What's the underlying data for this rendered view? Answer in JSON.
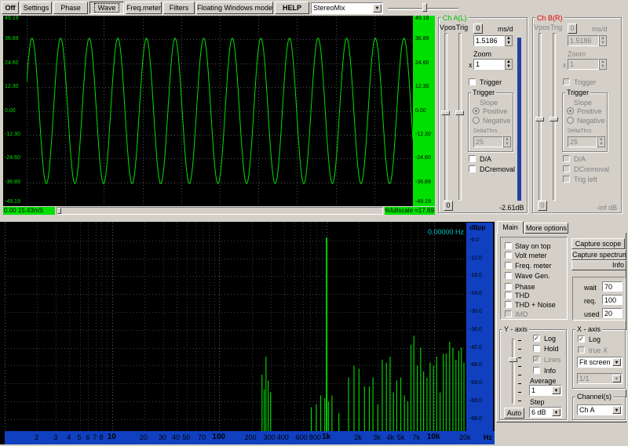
{
  "toolbar": {
    "off": "Off",
    "settings": "Settings",
    "phase": "Phase",
    "wave": "Wave",
    "freqmeter": "Freq.meter",
    "filters": "Filters",
    "floating": "Floating Windows mode",
    "help": "HELP",
    "source": "StereoMix"
  },
  "scope": {
    "y_ticks_left": [
      "49.19",
      "36.89",
      "24.60",
      "12.30",
      "0.00",
      "-12.30",
      "-24.60",
      "-36.89",
      "-49.19"
    ],
    "y_ticks_right": [
      "49.19",
      "36.89",
      "24.60",
      "12.30",
      "0.00",
      "-12.30",
      "-24.60",
      "-36.89",
      "-49.19"
    ],
    "time_readout": "0.00    15.43mS",
    "fullscale_readout": "%fullscale =17.69",
    "wave_cycles": 13.5,
    "trace_color": "#00e000"
  },
  "channel_a": {
    "title": "Ch A(L)",
    "vpos_label": "Vpos",
    "trig_label": "Trig",
    "zero_button": "0",
    "ms_div_label": "ms/d",
    "ms_div_value": "1.5186",
    "zoom_label": "Zoom",
    "zoom_prefix": "x",
    "zoom_value": "1",
    "trigger_check": "Trigger",
    "trigger_group": "Trigger",
    "slope_label": "Slope",
    "positive": "Positive",
    "negative": "Negative",
    "delta_label": "DeltaThrs",
    "delta_value": "25",
    "da_check": "D/A",
    "dcremoval_check": "DCremoval",
    "zero_bottom": "0",
    "level_readout": "-2.61dB",
    "level_fraction": 0.93
  },
  "channel_b": {
    "title": "Ch B(R)",
    "vpos_label": "Vpos",
    "trig_label": "Trig",
    "zero_button": "0",
    "ms_div_label": "ms/d",
    "ms_div_value": "1.5186",
    "zoom_label": "Zoom",
    "zoom_prefix": "x",
    "zoom_value": "1",
    "trigger_check": "Trigger",
    "trigger_group": "Trigger",
    "slope_label": "Slope",
    "positive": "Positive",
    "negative": "Negative",
    "delta_label": "DeltaThrs",
    "delta_value": "25",
    "da_check": "D/A",
    "dcremoval_check": "DCremoval",
    "trigleft_check": "Trig left",
    "zero_bottom": "0",
    "level_readout": "-inf dB"
  },
  "spectrum": {
    "freq_readout": "0.00000 Hz",
    "y_unit": "dBpp",
    "y_ticks": [
      "-6.0",
      "-12.0",
      "-18.0",
      "-24.0",
      "-30.0",
      "-36.0",
      "-42.0",
      "-48.0",
      "-54.0",
      "-60.0",
      "-66.0"
    ],
    "x_ticks": [
      {
        "f": 2,
        "label": "2",
        "bold": false
      },
      {
        "f": 3,
        "label": "3",
        "bold": false
      },
      {
        "f": 4,
        "label": "4",
        "bold": false
      },
      {
        "f": 5,
        "label": "5",
        "bold": false
      },
      {
        "f": 6,
        "label": "6",
        "bold": false
      },
      {
        "f": 7,
        "label": "7",
        "bold": false
      },
      {
        "f": 8,
        "label": "8",
        "bold": false
      },
      {
        "f": 10,
        "label": "10",
        "bold": true
      },
      {
        "f": 20,
        "label": "20",
        "bold": false
      },
      {
        "f": 30,
        "label": "30",
        "bold": false
      },
      {
        "f": 40,
        "label": "40",
        "bold": false
      },
      {
        "f": 50,
        "label": "50",
        "bold": false
      },
      {
        "f": 70,
        "label": "70",
        "bold": false
      },
      {
        "f": 100,
        "label": "100",
        "bold": true
      },
      {
        "f": 200,
        "label": "200",
        "bold": false
      },
      {
        "f": 300,
        "label": "300",
        "bold": false
      },
      {
        "f": 400,
        "label": "400",
        "bold": false
      },
      {
        "f": 600,
        "label": "600",
        "bold": false
      },
      {
        "f": 800,
        "label": "800",
        "bold": false
      },
      {
        "f": 1000,
        "label": "1k",
        "bold": true
      },
      {
        "f": 2000,
        "label": "2k",
        "bold": false
      },
      {
        "f": 3000,
        "label": "3k",
        "bold": false
      },
      {
        "f": 4000,
        "label": "4k",
        "bold": false
      },
      {
        "f": 5000,
        "label": "5k",
        "bold": false
      },
      {
        "f": 7000,
        "label": "7k",
        "bold": false
      },
      {
        "f": 10000,
        "label": "10k",
        "bold": true
      },
      {
        "f": 20000,
        "label": "20k",
        "bold": false
      }
    ],
    "x_unit": "Hz",
    "x_range_hz": [
      1,
      20000
    ],
    "y_range_db": [
      0,
      -70
    ],
    "peaks": [
      {
        "f": 250,
        "db": -51
      },
      {
        "f": 262,
        "db": -56
      },
      {
        "f": 272,
        "db": -45
      },
      {
        "f": 285,
        "db": -53
      },
      {
        "f": 300,
        "db": -57
      },
      {
        "f": 720,
        "db": -62
      },
      {
        "f": 800,
        "db": -61
      },
      {
        "f": 880,
        "db": -58
      },
      {
        "f": 960,
        "db": -59
      },
      {
        "f": 1000,
        "db": -5
      },
      {
        "f": 1040,
        "db": -60
      },
      {
        "f": 1120,
        "db": -58
      },
      {
        "f": 1300,
        "db": -64
      },
      {
        "f": 1600,
        "db": -52
      },
      {
        "f": 1800,
        "db": -48
      },
      {
        "f": 2000,
        "db": -49
      },
      {
        "f": 2250,
        "db": -55
      },
      {
        "f": 2500,
        "db": -55
      },
      {
        "f": 2700,
        "db": -52
      },
      {
        "f": 3000,
        "db": -61
      },
      {
        "f": 3300,
        "db": -46
      },
      {
        "f": 3600,
        "db": -47
      },
      {
        "f": 3900,
        "db": -45
      },
      {
        "f": 4200,
        "db": -57
      },
      {
        "f": 4500,
        "db": -53
      },
      {
        "f": 4900,
        "db": -52
      },
      {
        "f": 5300,
        "db": -58
      },
      {
        "f": 5700,
        "db": -60
      },
      {
        "f": 6100,
        "db": -41
      },
      {
        "f": 6500,
        "db": -38
      },
      {
        "f": 7000,
        "db": -48
      },
      {
        "f": 7500,
        "db": -42
      },
      {
        "f": 8000,
        "db": -50
      },
      {
        "f": 8600,
        "db": -52
      },
      {
        "f": 9200,
        "db": -47
      },
      {
        "f": 9900,
        "db": -48
      },
      {
        "f": 10600,
        "db": -45
      },
      {
        "f": 11400,
        "db": -57
      },
      {
        "f": 12200,
        "db": -44
      },
      {
        "f": 13000,
        "db": -44
      },
      {
        "f": 14000,
        "db": -40
      },
      {
        "f": 15000,
        "db": -42
      },
      {
        "f": 16000,
        "db": -46
      },
      {
        "f": 17000,
        "db": -43
      },
      {
        "f": 18000,
        "db": -42
      },
      {
        "f": 19000,
        "db": -47
      }
    ]
  },
  "tabs": {
    "main": "Main",
    "more": "More options"
  },
  "options": {
    "stay_on_top": "Stay on top",
    "volt_meter": "Volt meter",
    "freq_meter": "Freq. meter",
    "wave_gen": "Wave Gen.",
    "phase": "Phase",
    "thd": "THD",
    "thd_noise": "THD + Noise",
    "imd": "IMD"
  },
  "capture": {
    "scope": "Capture scope",
    "spectrum": "Capture spectrum",
    "info": "Info"
  },
  "avg": {
    "wait_label": "wait",
    "wait_value": "70",
    "req_label": "req.",
    "req_value": "100",
    "used_label": "used",
    "used_value": "20"
  },
  "yaxis": {
    "title": "Y - axis",
    "log": "Log",
    "hold": "Hold",
    "lines": "Lines",
    "info": "Info",
    "average_label": "Average",
    "average_value": "1",
    "step_label": "Step",
    "step_value": "6 dB",
    "auto_button": "Auto"
  },
  "xaxis": {
    "title": "X - axis",
    "log": "Log",
    "true_x": "true X",
    "fit_value": "Fit screen",
    "ratio_value": "1/1"
  },
  "channels": {
    "title": "Channel(s)",
    "value": "Ch A"
  }
}
